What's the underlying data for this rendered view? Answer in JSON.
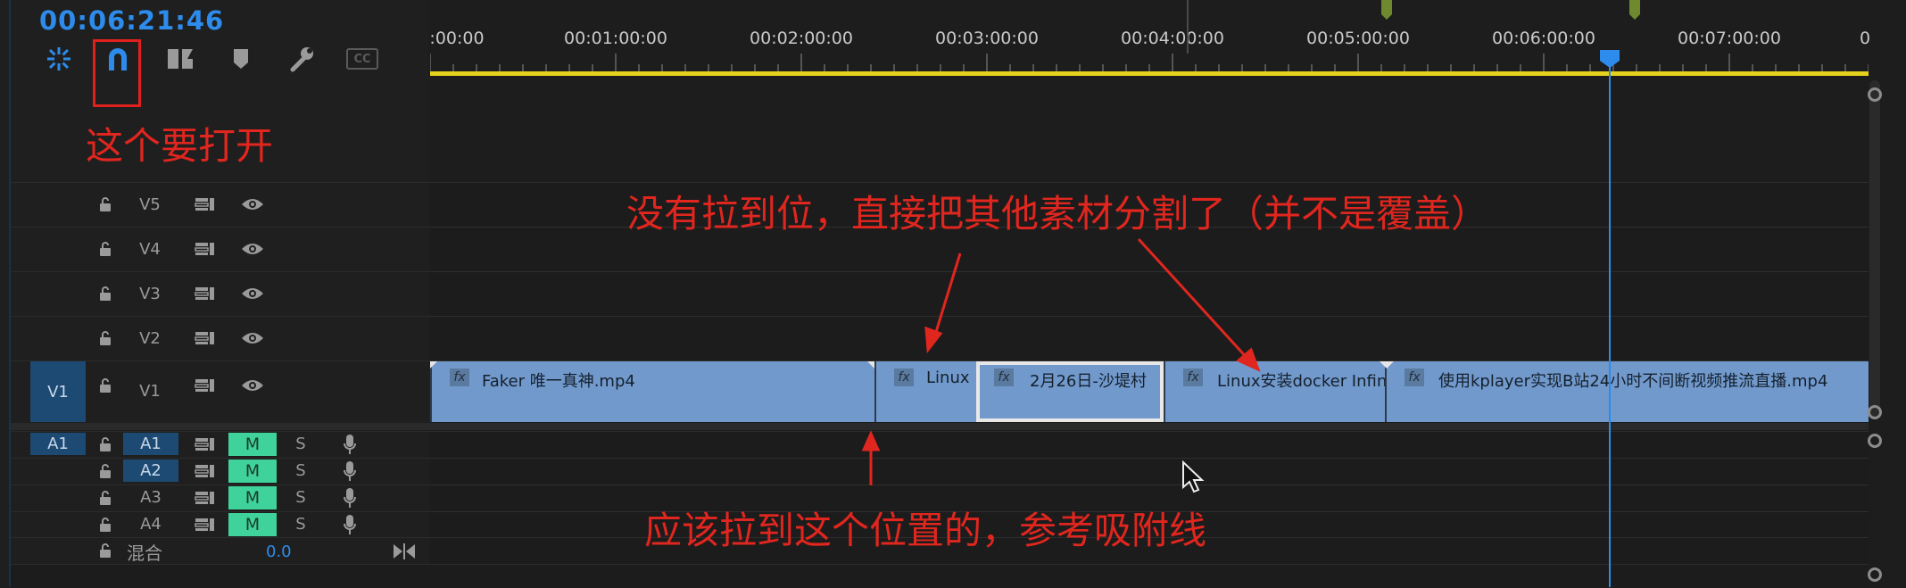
{
  "timecode": "00:06:21:46",
  "toolbar": {
    "icons": [
      "nest-sequence-icon",
      "snap-magnet-icon",
      "linked-selection-icon",
      "add-marker-icon",
      "wrench-settings-icon",
      "captions-icon"
    ],
    "captions_label": "CC"
  },
  "ruler": {
    "labels": [
      ":00:00",
      "00:01:00:00",
      "00:02:00:00",
      "00:03:00:00",
      "00:04:00:00",
      "00:05:00:00",
      "00:06:00:00",
      "00:07:00:00",
      "0"
    ],
    "label_seconds": [
      0,
      60,
      120,
      180,
      240,
      300,
      360,
      420,
      480
    ],
    "work_area_color": "#e6d21c",
    "playhead_seconds": 381.8,
    "playhead_color": "#2d8ceb"
  },
  "annotations": {
    "snap_hint": "这个要打开",
    "split_hint": "没有拉到位，直接把其他素材分割了（并不是覆盖）",
    "position_hint": "应该拉到这个位置的，参考吸附线",
    "color": "#e0261e"
  },
  "video_tracks": [
    {
      "name": "V5"
    },
    {
      "name": "V4"
    },
    {
      "name": "V3"
    },
    {
      "name": "V2"
    },
    {
      "name": "V1",
      "source_target": "V1"
    }
  ],
  "audio_tracks": [
    {
      "source_target": "A1",
      "name": "A1",
      "mute": "M",
      "solo": "S"
    },
    {
      "name": "A2",
      "mute": "M",
      "solo": "S"
    },
    {
      "name": "A3",
      "mute": "M",
      "solo": "S"
    },
    {
      "name": "A4",
      "mute": "M",
      "solo": "S"
    }
  ],
  "mix_track": {
    "label": "混合",
    "value": "0.0"
  },
  "clips": [
    {
      "name": "Faker 唯一真神.mp4",
      "fx": "fx"
    },
    {
      "name": "Linux",
      "fx": "fx"
    },
    {
      "name": "2月26日-沙堤村",
      "fx": "fx"
    },
    {
      "name": "Linux安装docker Infini",
      "fx": "fx"
    },
    {
      "name": "使用kplayer实现B站24小时不间断视频推流直播.mp4",
      "fx": "fx"
    }
  ],
  "clip_color": "#7199cc"
}
